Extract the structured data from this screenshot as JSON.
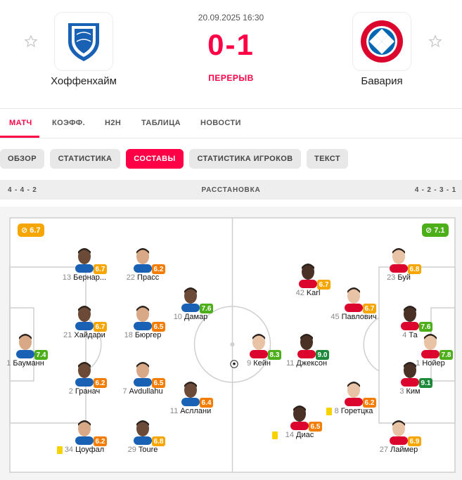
{
  "match": {
    "datetime": "20.09.2025 16:30",
    "score": "0-1",
    "status": "ПЕРЕРЫВ",
    "home": {
      "name": "Хоффенхайм",
      "color": "#1961b5"
    },
    "away": {
      "name": "Бавария",
      "color": "#dc052d"
    }
  },
  "tabs": [
    {
      "label": "МАТЧ"
    },
    {
      "label": "КОЭФФ."
    },
    {
      "label": "H2H"
    },
    {
      "label": "ТАБЛИЦА"
    },
    {
      "label": "НОВОСТИ"
    }
  ],
  "subtabs": [
    {
      "label": "ОБЗОР"
    },
    {
      "label": "СТАТИСТИКА"
    },
    {
      "label": "СОСТАВЫ"
    },
    {
      "label": "СТАТИСТИКА ИГРОКОВ"
    },
    {
      "label": "ТЕКСТ"
    }
  ],
  "formation": {
    "home": "4 - 4 - 2",
    "title": "РАССТАНОВКА",
    "away": "4 - 2 - 3 - 1"
  },
  "team_ratings": {
    "home": "6.7",
    "away": "7.1"
  },
  "colors": {
    "accent": "#ff0046",
    "rating_green": "#4caf1a",
    "rating_dark_green": "#1c8a3a",
    "rating_orange": "#f27d00",
    "rating_yellow_orange": "#f7a600"
  },
  "home_players": [
    {
      "num": "13",
      "name": "Бернар...",
      "rating": "6.7"
    },
    {
      "num": "22",
      "name": "Прасс",
      "rating": "6.2"
    },
    {
      "num": "21",
      "name": "Хайдари",
      "rating": "6.7"
    },
    {
      "num": "18",
      "name": "Бюргер",
      "rating": "6.5"
    },
    {
      "num": "10",
      "name": "Дамар",
      "rating": "7.6"
    },
    {
      "num": "1",
      "name": "Бауманн",
      "rating": "7.4"
    },
    {
      "num": "2",
      "name": "Гранач",
      "rating": "6.2"
    },
    {
      "num": "7",
      "name": "Avdullahu",
      "rating": "6.5"
    },
    {
      "num": "11",
      "name": "Асллани",
      "rating": "6.4"
    },
    {
      "num": "34",
      "name": "Цоуфал",
      "rating": "6.2"
    },
    {
      "num": "29",
      "name": "Toure",
      "rating": "6.8"
    }
  ],
  "away_players": [
    {
      "num": "23",
      "name": "Буй",
      "rating": "6.8"
    },
    {
      "num": "42",
      "name": "Karl",
      "rating": "6.7"
    },
    {
      "num": "45",
      "name": "Павлович",
      "rating": "6.7"
    },
    {
      "num": "4",
      "name": "Та",
      "rating": "7.6"
    },
    {
      "num": "9",
      "name": "Кейн",
      "rating": "8.3"
    },
    {
      "num": "11",
      "name": "Джексон",
      "rating": "9.0"
    },
    {
      "num": "1",
      "name": "Нойер",
      "rating": "7.8"
    },
    {
      "num": "3",
      "name": "Ким",
      "rating": "9.1"
    },
    {
      "num": "8",
      "name": "Горетцка",
      "rating": "6.2"
    },
    {
      "num": "14",
      "name": "Диас",
      "rating": "6.5"
    },
    {
      "num": "27",
      "name": "Лаймер",
      "rating": "6.9"
    }
  ]
}
